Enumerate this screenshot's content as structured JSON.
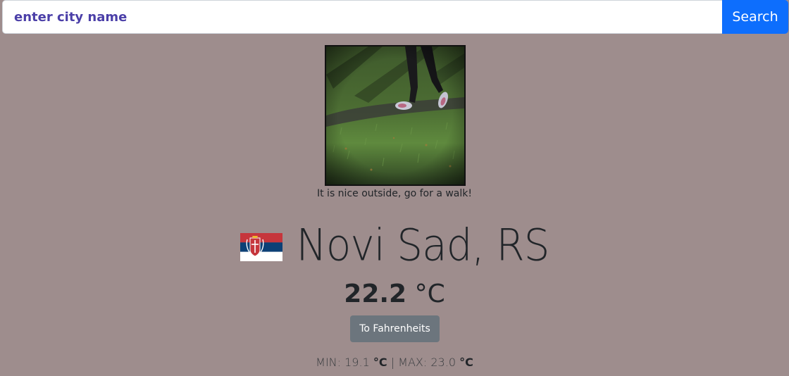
{
  "search": {
    "placeholder": "enter city name",
    "button_label": "Search"
  },
  "weather": {
    "image_icon": "walking-in-grass-photo",
    "caption": "It is nice outside, go for a walk!",
    "country_flag_icon": "serbia-flag-icon",
    "city": "Novi Sad, RS",
    "temperature": "22.2",
    "unit": "°C",
    "convert_label": "To Fahrenheits",
    "min_label": "MIN:",
    "min_value": "19.1",
    "max_label": "MAX:",
    "max_value": "23.0",
    "separator": "|"
  },
  "colors": {
    "background": "#9e8d8d",
    "search_button": "#0d6efd",
    "convert_button": "#6c757d",
    "placeholder_text": "#4b3fa8"
  }
}
